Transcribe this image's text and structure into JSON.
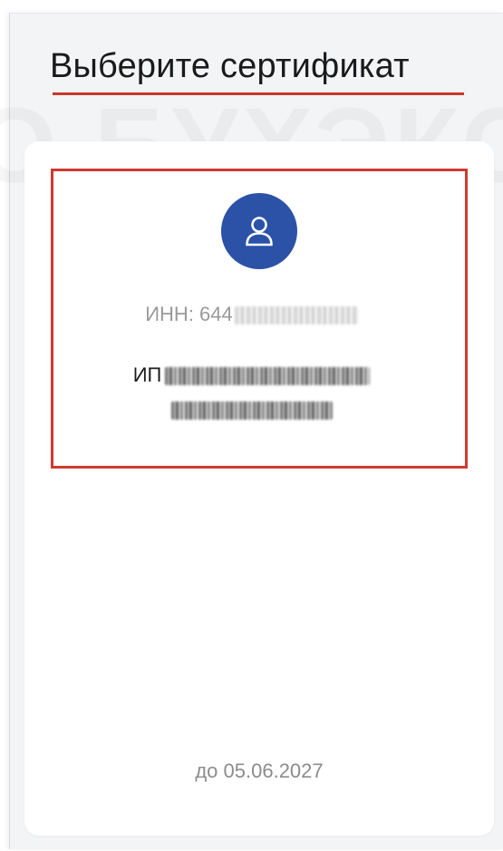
{
  "header": {
    "title": "Выберите сертификат"
  },
  "certificate": {
    "inn_label": "ИНН: 644",
    "owner_prefix": "ИП",
    "expiry": "до 05.06.2027",
    "avatar_icon": "user-icon"
  },
  "colors": {
    "accent_blue": "#2b52a7",
    "highlight_red": "#cf3a30"
  }
}
